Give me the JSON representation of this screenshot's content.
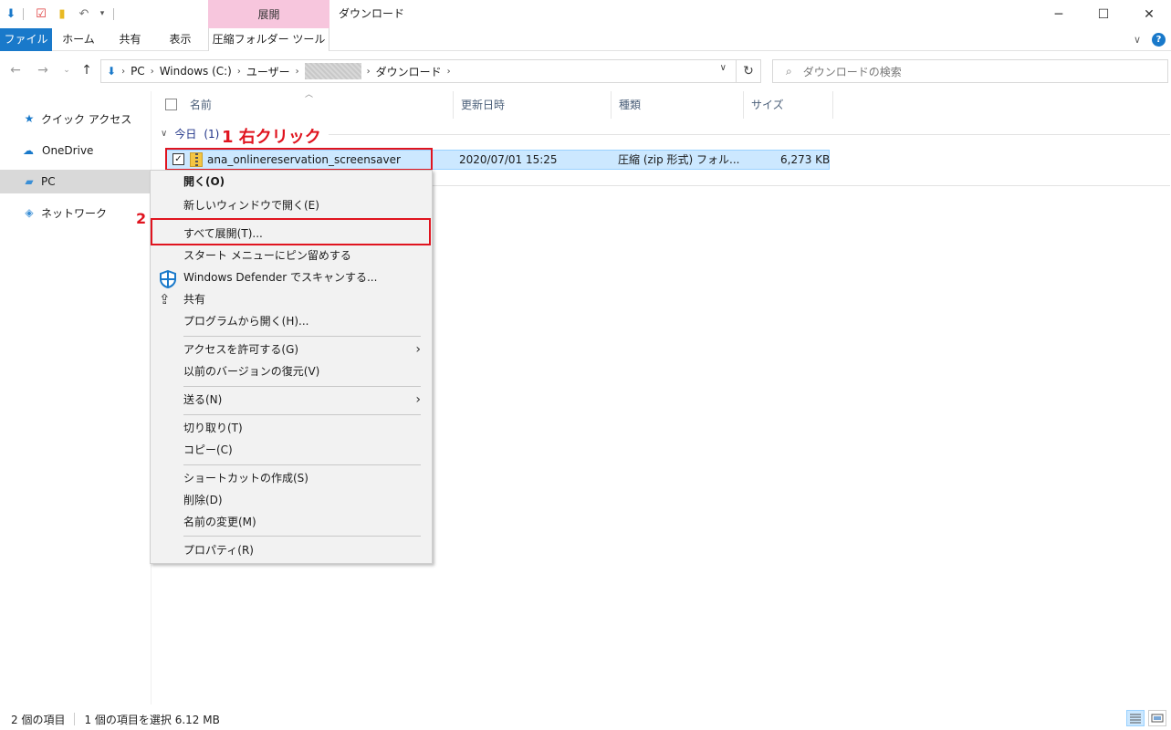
{
  "window": {
    "title": "ダウンロード",
    "context_tab_header": "展開",
    "controls": {
      "minimize": "─",
      "maximize": "☐",
      "close": "✕"
    }
  },
  "ribbon": {
    "tabs": [
      "ファイル",
      "ホーム",
      "共有",
      "表示",
      "圧縮フォルダー ツール"
    ],
    "help": "?"
  },
  "address": {
    "crumbs": [
      "PC",
      "Windows (C:)",
      "ユーザー",
      "ダウンロード"
    ],
    "search_placeholder": "ダウンロードの検索"
  },
  "navpane": {
    "items": [
      {
        "label": "クイック アクセス",
        "icon": "star-icon"
      },
      {
        "label": "OneDrive",
        "icon": "cloud-icon"
      },
      {
        "label": "PC",
        "icon": "computer-icon"
      },
      {
        "label": "ネットワーク",
        "icon": "network-icon"
      }
    ]
  },
  "filelist": {
    "columns": [
      "名前",
      "更新日時",
      "種類",
      "サイズ"
    ],
    "group": {
      "label": "今日",
      "count": "(1)"
    },
    "rows": [
      {
        "name": "ana_onlinereservation_screensaver",
        "modified": "2020/07/01 15:25",
        "type": "圧縮 (zip 形式) フォル...",
        "size": "6,273 KB",
        "checked": true
      }
    ]
  },
  "annotations": {
    "step1": "1 右クリック",
    "step2": "2"
  },
  "context_menu": {
    "items": [
      "開く(O)",
      "新しいウィンドウで開く(E)",
      "すべて展開(T)...",
      "スタート メニューにピン留めする",
      "Windows Defender でスキャンする...",
      "共有",
      "プログラムから開く(H)...",
      "アクセスを許可する(G)",
      "以前のバージョンの復元(V)",
      "送る(N)",
      "切り取り(T)",
      "コピー(C)",
      "ショートカットの作成(S)",
      "削除(D)",
      "名前の変更(M)",
      "プロパティ(R)"
    ]
  },
  "status": {
    "count": "2 個の項目",
    "selected": "1 個の項目を選択  6.12 MB"
  },
  "colors": {
    "accent": "#1979ca",
    "selection": "#cce8ff",
    "annotation": "#e0141f",
    "context_tab": "#f7c6dd"
  }
}
